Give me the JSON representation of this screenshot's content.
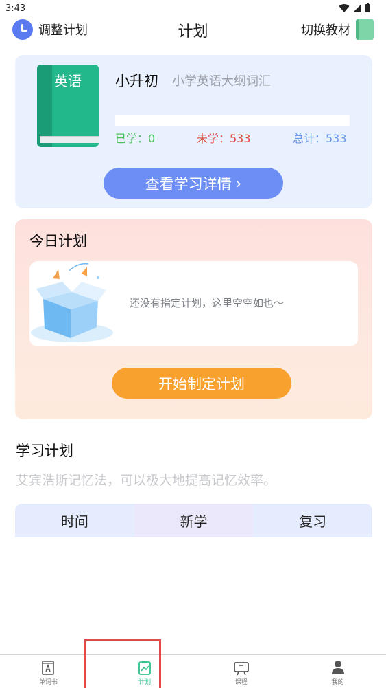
{
  "status_bar": {
    "time": "3:43"
  },
  "nav": {
    "left_label": "调整计划",
    "title": "计划",
    "right_label": "切换教材"
  },
  "book": {
    "cover_text": "英语",
    "name": "小升初",
    "subtitle": "小学英语大纲词汇",
    "progress_fraction": 0,
    "learned": "已学：0",
    "unlearned": "未学：533",
    "total": "总计：533",
    "detail_button": "查看学习详情",
    "detail_arrow": "›"
  },
  "today_plan": {
    "title": "今日计划",
    "empty_text": "还没有指定计划，这里空空如也～",
    "start_button": "开始制定计划"
  },
  "study_plan": {
    "title": "学习计划",
    "description": "艾宾浩斯记忆法，可以极大地提高记忆效率。",
    "columns": [
      "时间",
      "新学",
      "复习"
    ]
  },
  "tab_bar": {
    "tabs": [
      {
        "label": "单词书",
        "icon": "word-book-icon"
      },
      {
        "label": "计划",
        "icon": "plan-chart-icon",
        "active": true
      },
      {
        "label": "课程",
        "icon": "course-screen-icon"
      },
      {
        "label": "我的",
        "icon": "person-icon"
      }
    ]
  },
  "colors": {
    "accent_blue": "#6d8ef5",
    "accent_orange": "#f8a12f",
    "learned_green": "#4cbf5c",
    "unlearned_red": "#e0463e",
    "total_blue": "#6a96e8",
    "active_tab": "#33c08b"
  }
}
